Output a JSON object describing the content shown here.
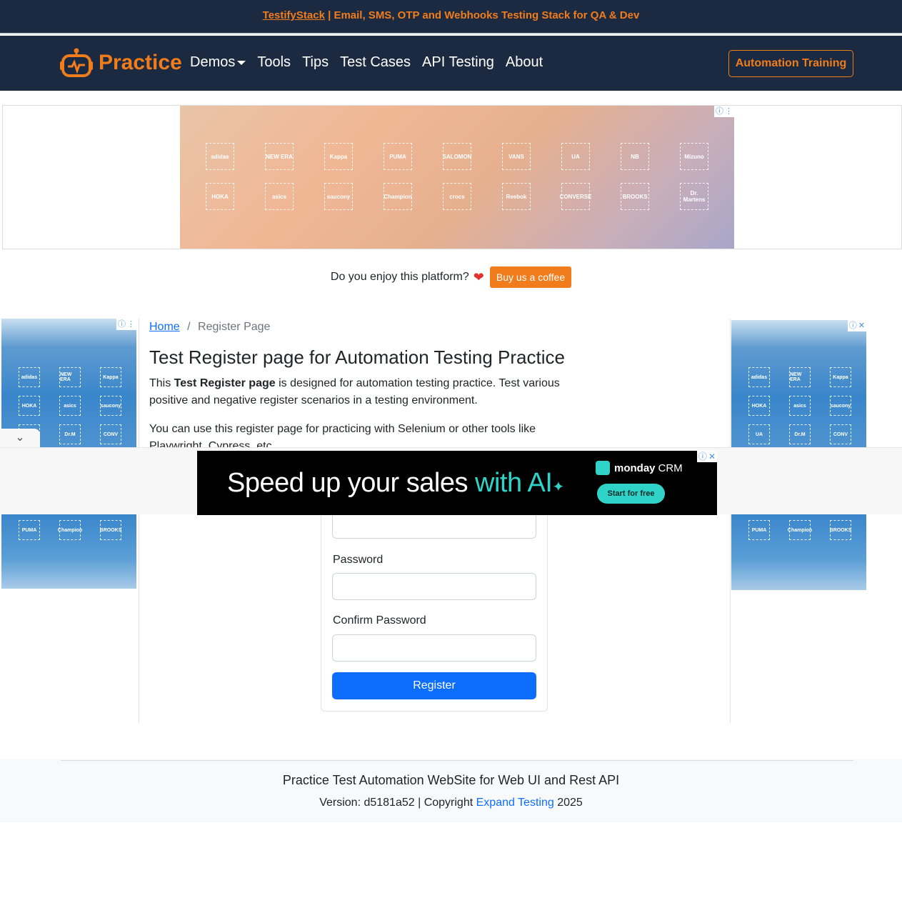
{
  "promo": {
    "link": "TestifyStack",
    "text": " | Email, SMS, OTP and Webhooks Testing Stack for QA & Dev"
  },
  "navbar": {
    "brand": "Practice",
    "links": [
      "Demos",
      "Tools",
      "Tips",
      "Test Cases",
      "API Testing",
      "About"
    ],
    "cta": "Automation Training"
  },
  "top_ad": {
    "brands": [
      "adidas",
      "NEW ERA",
      "Kappa",
      "PUMA",
      "SALOMON",
      "VANS",
      "UA",
      "NB",
      "Mizuno",
      "HOKA",
      "asics",
      "saucony",
      "Champion",
      "crocs",
      "Reebok",
      "CONVERSE",
      "BROOKS",
      "Dr. Martens"
    ]
  },
  "coffee": {
    "question": "Do you enjoy this platform?",
    "button": "Buy us a coffee"
  },
  "side_ads": {
    "left_top": [
      "adidas",
      "NEW ERA",
      "Kappa",
      "HOKA",
      "asics",
      "saucony",
      "UA",
      "Dr.M",
      "CONV"
    ],
    "left_bottom": [
      "PUMA",
      "Champion",
      "BROOKS"
    ],
    "right_top": [
      "adidas",
      "NEW ERA",
      "Kappa",
      "HOKA",
      "asics",
      "saucony",
      "UA",
      "Dr.M",
      "CONV"
    ],
    "right_bottom": [
      "PUMA",
      "Champion",
      "BROOKS"
    ]
  },
  "breadcrumb": {
    "home": "Home",
    "separator": "/",
    "current": "Register Page"
  },
  "main": {
    "title": "Test Register page for Automation Testing Practice",
    "intro_prefix": "This ",
    "intro_bold": "Test Register page",
    "intro_suffix": " is designed for automation testing practice. Test various positive and negative register scenarios in a testing environment.",
    "tools_text": "You can use this register page for practicing with Selenium or other tools like Playwright, Cypress, etc."
  },
  "sticky_ad": {
    "headline_prefix": "Speed up your sales ",
    "headline_ai": "with AI",
    "brand": "monday",
    "brand_suffix": "CRM",
    "button": "Start for free"
  },
  "form": {
    "password_label": "Password",
    "confirm_label": "Confirm Password",
    "submit": "Register"
  },
  "footer": {
    "title": "Practice Test Automation WebSite for Web UI and Rest API",
    "version": "Version: d5181a52 | Copyright ",
    "company": "Expand Testing",
    "year": " 2025"
  }
}
